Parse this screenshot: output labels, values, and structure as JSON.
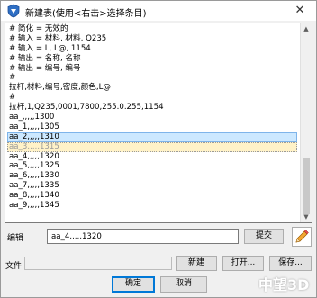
{
  "window": {
    "title": "新建表(使用<右击>选择条目)",
    "close_glyph": "✕"
  },
  "list": {
    "lines": [
      "# 简化 = 无效的",
      "# 输入 = 材料, 材料, Q235",
      "# 输入 = L, L@, 1154",
      "# 输出 = 名称, 名称",
      "# 输出 = 编号, 编号",
      "#",
      "拉杆,材料,编号,密度,颜色,L@",
      "#",
      "拉杆,1,Q235,0001,7800,255.0.255,1154",
      "aa_,,,,,1300",
      "aa_1,,,,,1305",
      "aa_2,,,,,1310",
      "aa_3,,,,,1315",
      "aa_4,,,,,1320",
      "aa_5,,,,,1325",
      "aa_6,,,,,1330",
      "aa_7,,,,,1335",
      "aa_8,,,,,1340",
      "aa_9,,,,,1345"
    ],
    "selected_index": 11,
    "highlight_index": 12
  },
  "edit": {
    "label": "编辑",
    "value": "aa_4,,,,,1320",
    "submit_label": "提交",
    "pencil_icon": "pencil-icon"
  },
  "file": {
    "label": "文件",
    "value": "",
    "new_label": "新建",
    "open_label": "打开...",
    "save_label": "保存..."
  },
  "footer": {
    "ok_label": "确定",
    "cancel_label": "取消"
  },
  "watermark": "中望3D",
  "colors": {
    "selection": "#cce8ff",
    "highlight": "#fff2c8",
    "default_border": "#0078d7"
  }
}
